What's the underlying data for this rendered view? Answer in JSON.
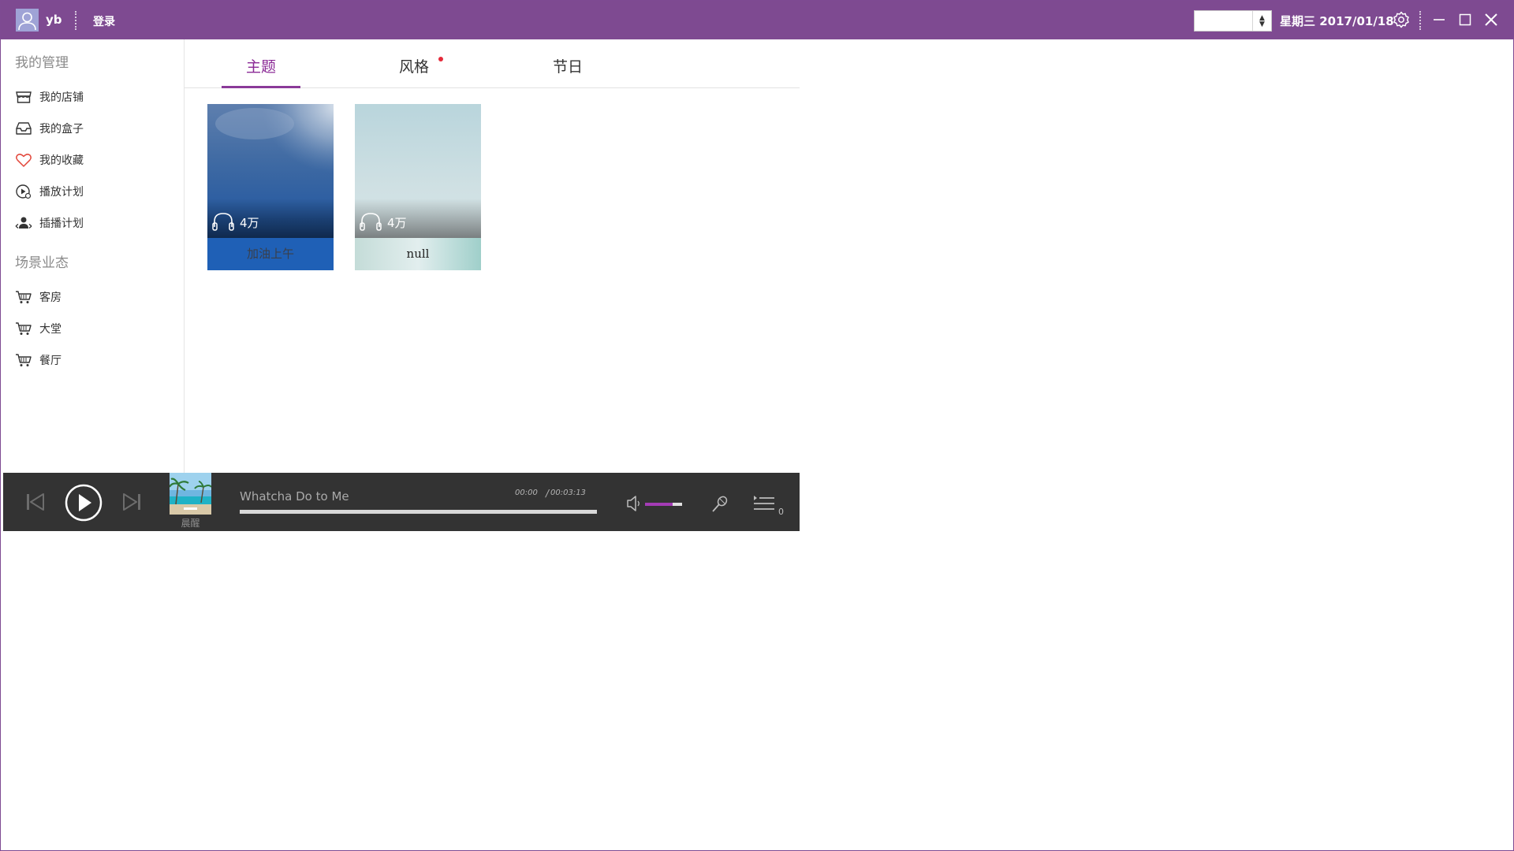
{
  "titlebar": {
    "username": "yb",
    "login_label": "登录",
    "select_value": "",
    "date": "星期三 2017/01/18",
    "bg_color": "#7e4a91"
  },
  "sidebar": {
    "section1_title": "我的管理",
    "section1_items": [
      {
        "label": "我的店铺",
        "icon": "store-icon"
      },
      {
        "label": "我的盒子",
        "icon": "inbox-icon"
      },
      {
        "label": "我的收藏",
        "icon": "heart-icon"
      },
      {
        "label": "播放计划",
        "icon": "play-schedule-icon"
      },
      {
        "label": "插播计划",
        "icon": "insert-schedule-icon"
      }
    ],
    "section2_title": "场景业态",
    "section2_items": [
      {
        "label": "客房",
        "icon": "cart-icon"
      },
      {
        "label": "大堂",
        "icon": "cart-icon"
      },
      {
        "label": "餐厅",
        "icon": "cart-icon"
      }
    ]
  },
  "tabs": [
    {
      "label": "主题",
      "active": true
    },
    {
      "label": "风格",
      "active": false,
      "badge": true
    },
    {
      "label": "节日",
      "active": false
    }
  ],
  "cards": [
    {
      "listen_count": "4万",
      "caption": "加油上午"
    },
    {
      "listen_count": "4万",
      "caption": "null"
    }
  ],
  "player": {
    "cover_label": "晨醒",
    "song_title": "Whatcha Do to Me",
    "time_current": "00:00",
    "time_separator": "/",
    "time_total": "00:03:13",
    "progress": 0,
    "volume": 0.75,
    "queue_count": "0",
    "accent_color": "#8c2fa1"
  }
}
